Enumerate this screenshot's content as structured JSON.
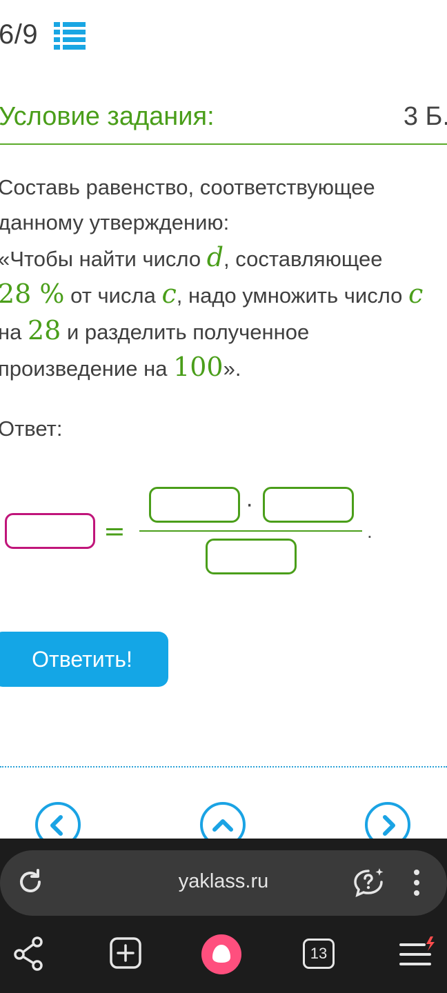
{
  "header": {
    "counter": "6/9",
    "list_icon": "list-icon"
  },
  "condition": {
    "title": "Условие задания:",
    "points": "3 Б."
  },
  "statement": {
    "p1": "Составь равенство, соответствующее данному утверждению:",
    "p2a": "«Чтобы найти число ",
    "var_d": "d",
    "p2b": ", составляющее",
    "pct": "28 %",
    "p3a": " от числа ",
    "var_c": "c",
    "p3b": ", надо умножить число ",
    "var_c2": "c",
    "p4a": "на ",
    "n28": "28",
    "p4b": " и разделить полученное",
    "p5a": "произведение на ",
    "n100": "100",
    "p5b": "»."
  },
  "answer": {
    "label": "Ответ:",
    "equals": "=",
    "dot": "·",
    "period": "."
  },
  "submit_label": "Ответить!",
  "browser": {
    "url": "yaklass.ru",
    "tab_count": "13"
  },
  "colors": {
    "accent_green": "#4a9e1a",
    "accent_blue": "#14a6e6",
    "left_box_border": "#c0157a",
    "home_button": "#ff4f7e"
  }
}
